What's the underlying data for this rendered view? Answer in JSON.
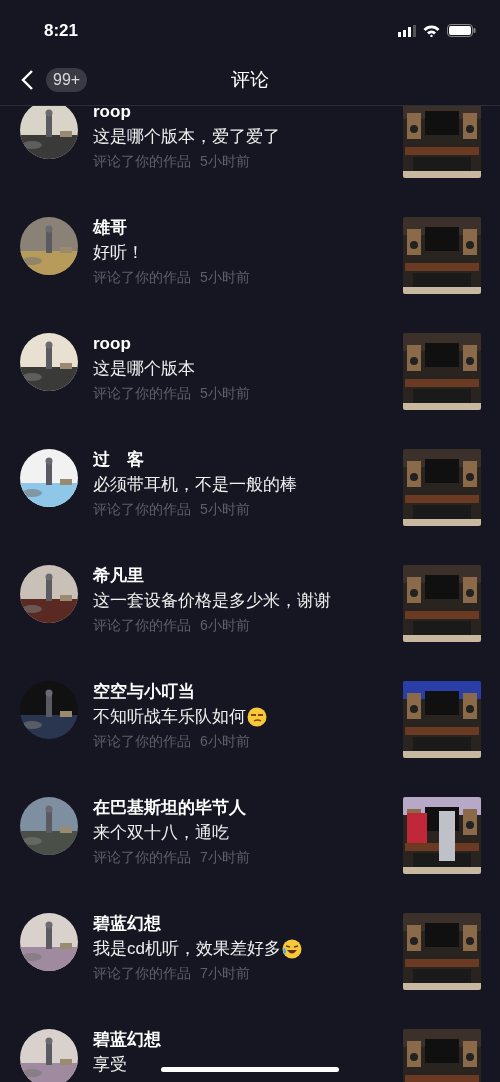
{
  "status_bar": {
    "time": "8:21"
  },
  "nav": {
    "badge": "99+",
    "title": "评论"
  },
  "notifications": [
    {
      "name": "roop",
      "comment": "这是哪个版本，爱了爱了",
      "action": "评论了你的作品",
      "time": "5小时前"
    },
    {
      "name": "雄哥",
      "comment": "好听！",
      "action": "评论了你的作品",
      "time": "5小时前"
    },
    {
      "name": "roop",
      "comment": "这是哪个版本",
      "action": "评论了你的作品",
      "time": "5小时前"
    },
    {
      "name": "过　客",
      "comment": "必须带耳机，不是一般的棒",
      "action": "评论了你的作品",
      "time": "5小时前"
    },
    {
      "name": "希凡里",
      "comment": "这一套设备价格是多少米，谢谢",
      "action": "评论了你的作品",
      "time": "6小时前"
    },
    {
      "name": "空空与小叮当",
      "comment": "不知听战车乐队如何",
      "emoji": {
        "kind": "smug"
      },
      "action": "评论了你的作品",
      "time": "6小时前"
    },
    {
      "name": "在巴基斯坦的毕节人",
      "comment": "来个双十八，通吃",
      "action": "评论了你的作品",
      "time": "7小时前"
    },
    {
      "name": "碧蓝幻想",
      "comment": "我是cd机听，效果差好多",
      "emoji": {
        "kind": "laughing"
      },
      "action": "评论了你的作品",
      "time": "7小时前"
    },
    {
      "name": "碧蓝幻想",
      "comment": "享受"
    }
  ]
}
